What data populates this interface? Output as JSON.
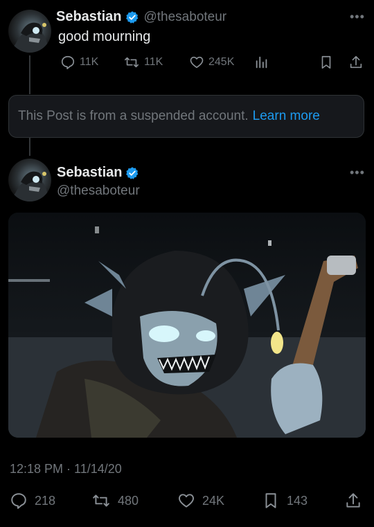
{
  "quoted_post": {
    "author_name": "Sebastian",
    "author_handle": "@thesaboteur",
    "text": "good mourning",
    "stats": {
      "replies": "11K",
      "reposts": "11K",
      "likes": "245K"
    }
  },
  "suspended_notice": {
    "text": "This Post is from a suspended account.",
    "link": "Learn more"
  },
  "main_post": {
    "author_name": "Sebastian",
    "author_handle": "@thesaboteur",
    "timestamp": "12:18 PM · 11/14/20",
    "stats": {
      "replies": "218",
      "reposts": "480",
      "likes": "24K",
      "bookmarks": "143"
    }
  },
  "icons": {
    "verified": "verified-badge-icon",
    "more": "more-dots-icon",
    "reply": "reply-icon",
    "repost": "repost-icon",
    "like": "heart-icon",
    "views": "analytics-icon",
    "bookmark": "bookmark-icon",
    "share": "share-icon"
  },
  "colors": {
    "background": "#000000",
    "text": "#e7e9ea",
    "secondary": "#71767b",
    "accent": "#1d9bf0",
    "card": "#16181c"
  }
}
